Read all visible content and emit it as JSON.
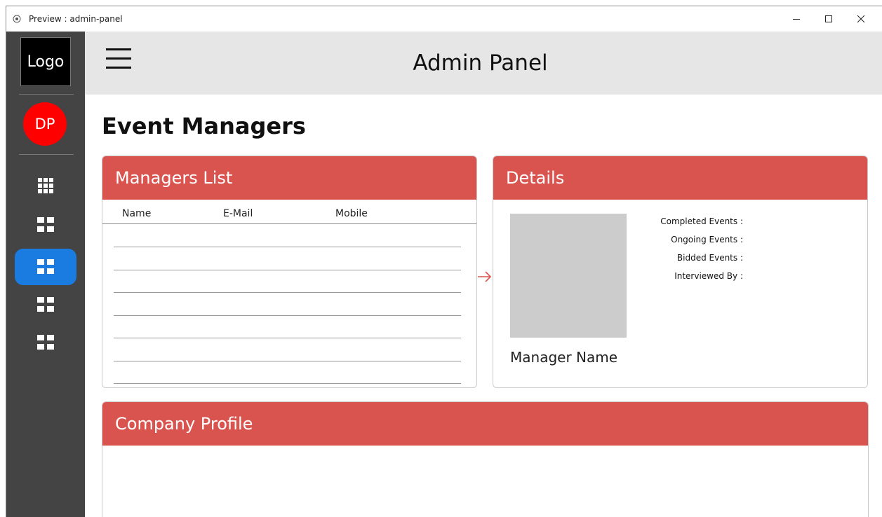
{
  "window": {
    "title": "Preview : admin-panel"
  },
  "sidebar": {
    "logo": "Logo",
    "avatar_initials": "DP",
    "items": [
      {
        "icon": "grid-3x3-icon",
        "active": false
      },
      {
        "icon": "grid-2x2-icon",
        "active": false
      },
      {
        "icon": "grid-2x2-icon",
        "active": true
      },
      {
        "icon": "grid-2x2-icon",
        "active": false
      },
      {
        "icon": "grid-2x2-icon",
        "active": false
      }
    ]
  },
  "header": {
    "title": "Admin Panel"
  },
  "page": {
    "title": "Event Managers"
  },
  "managers_list": {
    "title": "Managers List",
    "columns": [
      "Name",
      "E-Mail",
      "Mobile"
    ]
  },
  "details": {
    "title": "Details",
    "manager_name": "Manager Name",
    "stats": [
      "Completed Events :",
      "Ongoing Events :",
      "Bidded Events :",
      "Interviewed By :"
    ]
  },
  "company_profile": {
    "title": "Company Profile"
  },
  "colors": {
    "card_header": "#d9534f",
    "sidebar": "#444444",
    "active_nav": "#1a7be0",
    "avatar": "#ff0000",
    "header_bg": "#e6e6e6"
  }
}
